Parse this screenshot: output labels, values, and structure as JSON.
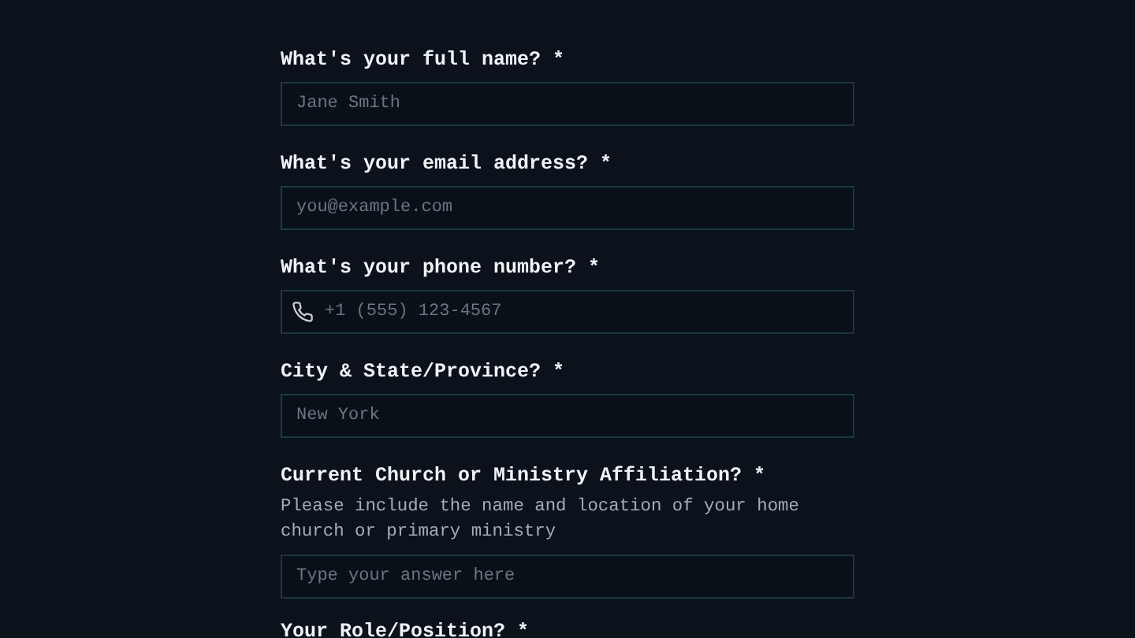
{
  "questions": [
    {
      "label": "What's your full name? *",
      "placeholder": "Jane Smith",
      "kind": "text"
    },
    {
      "label": "What's your email address? *",
      "placeholder": "you@example.com",
      "kind": "text"
    },
    {
      "label": "What's your phone number? *",
      "placeholder": "+1 (555) 123-4567",
      "kind": "phone"
    },
    {
      "label": "City & State/Province? *",
      "placeholder": "New York",
      "kind": "text"
    },
    {
      "label": "Current Church or Ministry Affiliation? *",
      "help": "Please include the name and location of your home church or primary ministry",
      "placeholder": "Type your answer here",
      "kind": "text"
    },
    {
      "label": "Your Role/Position? *",
      "kind": "cut"
    }
  ]
}
